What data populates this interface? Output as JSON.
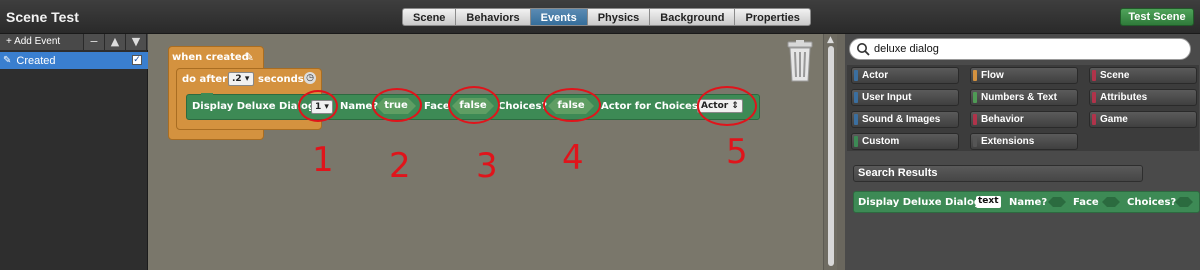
{
  "window": {
    "title": "Scene Test"
  },
  "tabs": [
    "Scene",
    "Behaviors",
    "Events",
    "Physics",
    "Background",
    "Properties"
  ],
  "active_tab": "Events",
  "test_button": "Test Scene",
  "left_panel": {
    "add_event": "+ Add Event",
    "remove": "−",
    "up": "▲",
    "down": "▼",
    "events": [
      {
        "label": "Created",
        "checked": true
      }
    ]
  },
  "canvas": {
    "when_created": "when created",
    "do_after_prefix": "do after",
    "do_after_value": ".2",
    "do_after_suffix": "seconds",
    "dialog_label": "Display Deluxe Dialog:",
    "dialog_value": "1",
    "name_label": "Name?",
    "name_value": "true",
    "face_label": "Face",
    "face_value": "false",
    "choices_label": "Choices?",
    "choices_value": "false",
    "actor_label": "Actor for Choices:",
    "actor_value": "Actor"
  },
  "annotations": [
    "1",
    "2",
    "3",
    "4",
    "5"
  ],
  "palette": {
    "search_value": "deluxe dialog",
    "categories": [
      {
        "label": "Actor",
        "color": "#3b6fa0"
      },
      {
        "label": "Flow",
        "color": "#d4923f"
      },
      {
        "label": "Scene",
        "color": "#b0334a"
      },
      {
        "label": "User Input",
        "color": "#3b6fa0"
      },
      {
        "label": "Numbers & Text",
        "color": "#4f9a55"
      },
      {
        "label": "Attributes",
        "color": "#b0334a"
      },
      {
        "label": "Sound & Images",
        "color": "#3b6fa0"
      },
      {
        "label": "Behavior",
        "color": "#b0334a"
      },
      {
        "label": "Game",
        "color": "#b0334a"
      },
      {
        "label": "Custom",
        "color": "#3d8a55"
      },
      {
        "label": "Extensions",
        "color": "#555555"
      }
    ],
    "search_results_title": "Search Results",
    "result": {
      "label": "Display Deluxe Dialog:",
      "text_chip": "text",
      "name_label": "Name?",
      "face_label": "Face",
      "choices_label": "Choices?"
    }
  }
}
